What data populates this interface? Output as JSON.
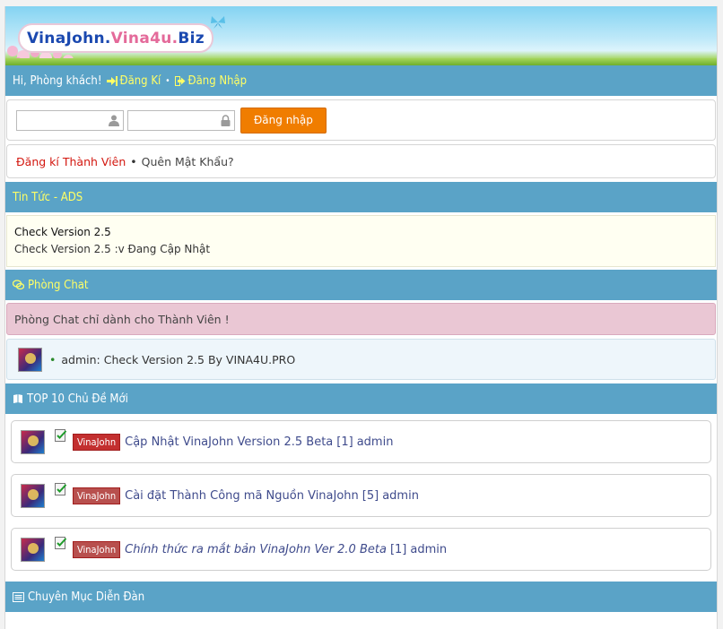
{
  "banner": {
    "logo_part1": "VinaJohn.",
    "logo_part2": "Vina4u.",
    "logo_part3": "Biz"
  },
  "greeting_bar": {
    "greeting": "Hi, Phòng khách!",
    "register_label": "Đăng Kí",
    "separator": "•",
    "login_label": "Đăng Nhập"
  },
  "login": {
    "username_placeholder": "",
    "password_placeholder": "",
    "username_value": "",
    "password_value": "",
    "submit_label": "Đăng nhập"
  },
  "register_row": {
    "register_label": "Đăng kí Thành Viên",
    "separator": "•",
    "forgot_label": "Quên Mật Khẩu?"
  },
  "news": {
    "header": "Tin Tức - ADS",
    "title": "Check Version 2.5",
    "body": "Check Version 2.5 :v Đang Cập Nhật"
  },
  "chat": {
    "header": "Phòng Chat",
    "note": "Phòng Chat chỉ dành cho Thành Viên !",
    "bullet": "•",
    "message": "admin: Check Version 2.5 By VINA4U.PRO"
  },
  "topics": {
    "header": "TOP 10 Chủ Đề Mới",
    "items": [
      {
        "tag": "VinaJohn",
        "title": "Cập Nhật VinaJohn Version 2.5 Beta",
        "count": "[1]",
        "user": "admin"
      },
      {
        "tag": "VinaJohn",
        "title": "Cài đặt Thành Công mã Nguồn VinaJohn",
        "count": "[5]",
        "user": "admin"
      },
      {
        "tag": "VinaJohn",
        "title": "Chính thức ra mắt bản VinaJohn Ver 2.0 Beta",
        "count": "[1]",
        "user": "admin"
      }
    ]
  },
  "forum": {
    "header": "Chuyên Mục Diễn Đàn"
  },
  "colors": {
    "bar_bg": "#5aa3c7",
    "bar_text": "#ffff66",
    "button_orange": "#f07d00",
    "tag_red": "#c32f2f",
    "register_red": "#d3170f"
  },
  "icons": [
    "sign-in-icon",
    "login-icon",
    "user-icon",
    "lock-icon",
    "chat-icon",
    "book-icon",
    "checklist-icon",
    "list-icon"
  ]
}
